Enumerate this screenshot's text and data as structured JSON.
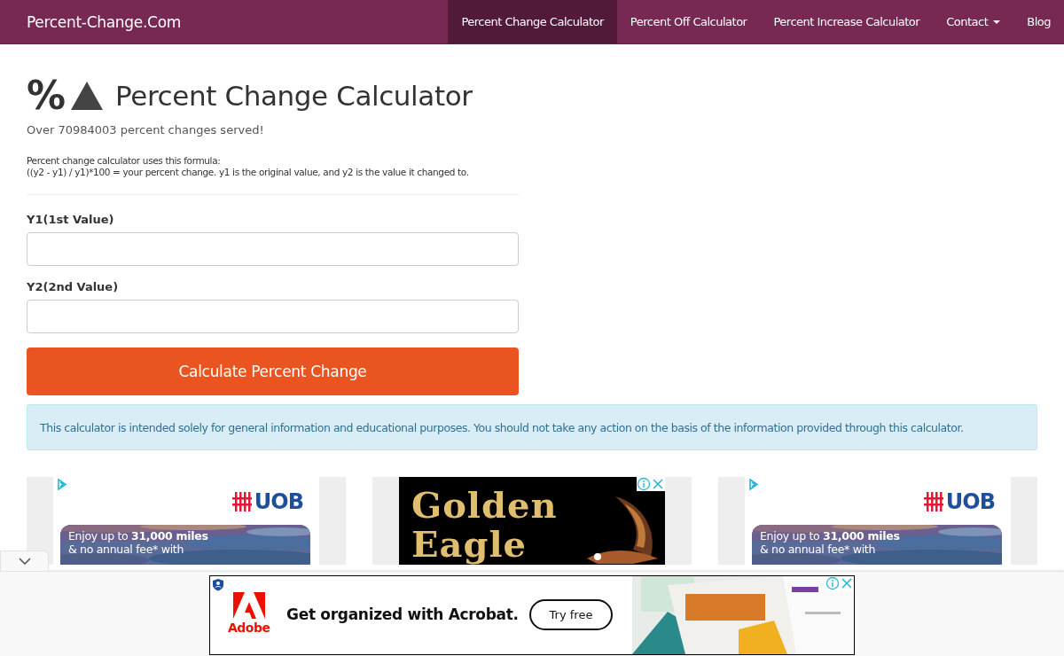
{
  "site": {
    "brand": "Percent-Change.Com",
    "nav": [
      {
        "label": "Percent Change Calculator",
        "selected": true,
        "kind": "link"
      },
      {
        "label": "Percent Off Calculator",
        "selected": false,
        "kind": "link"
      },
      {
        "label": "Percent Increase Calculator",
        "selected": false,
        "kind": "link"
      },
      {
        "label": "Contact",
        "selected": false,
        "kind": "dropdown"
      },
      {
        "label": "Blog",
        "selected": false,
        "kind": "link"
      }
    ]
  },
  "calculator": {
    "icon_text": "%",
    "title": "Percent Change Calculator",
    "served": "Over 70984003 percent changes served!",
    "formula_intro": "Percent change calculator uses this formula:",
    "formula": "((y2 - y1) / y1)*100 = your percent change. y1 is the original value, and y2 is the value it changed to.",
    "fields": [
      {
        "label": "Y1(1st Value)"
      },
      {
        "label": "Y2(2nd Value)"
      }
    ],
    "submit": "Calculate Percent Change",
    "notice": "This calculator is intended solely for general information and educational purposes. You should not take any action on the basis of the information provided through this calculator."
  },
  "ads": [
    {
      "kind": "card",
      "brand": "UOB",
      "line1": "Enjoy up to **31,000 miles**",
      "line2": "& no annual fee* with"
    },
    {
      "kind": "banner",
      "brand": "Golden",
      "brand2": "Eagle"
    },
    {
      "kind": "card",
      "brand": "UOB",
      "line1": "Enjoy up to **31,000 miles**",
      "line2": "& no annual fee* with"
    }
  ],
  "bottom_ad": {
    "brand": "Adobe",
    "headline": "Get organized with Acrobat.",
    "button": "Try free"
  }
}
